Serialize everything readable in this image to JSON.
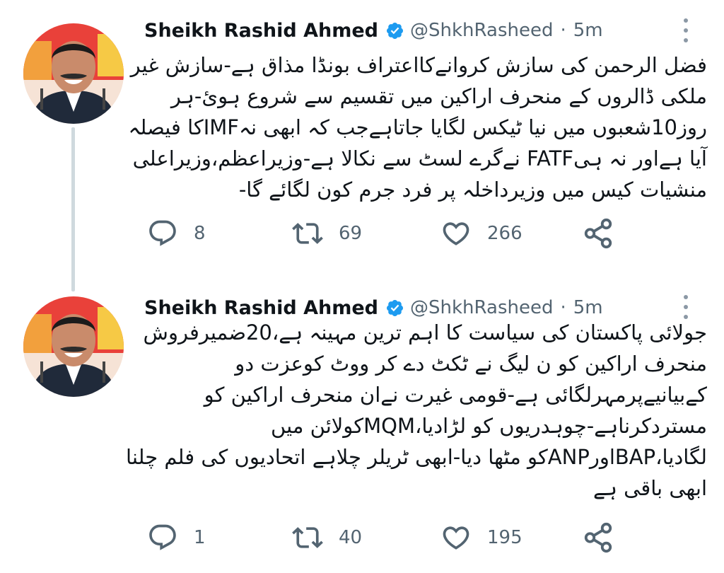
{
  "colors": {
    "verified": "#1d9bf0",
    "text": "#0f1419",
    "secondary": "#536471",
    "thread_line": "#cfd9de",
    "icon": "#536471"
  },
  "tweets": [
    {
      "author": {
        "name": "Sheikh Rashid Ahmed",
        "handle": "@ShkhRasheed",
        "verified": true
      },
      "separator": "·",
      "time": "5m",
      "text_lines": [
        "فضل الرحمن کی سازش کروانےکااعتراف بونڈا مذاق ہے-سازش غیر",
        "ملکی ڈالروں کے منحرف اراکین میں تقسیم سے شروع ہوئ-ہر",
        "روز10شعبوں میں نیا ٹیکس لگایا جاتاہےجب کہ ابھی نہIMFکا فیصلہ",
        "آیا ہےاور نہ ہیFATF نےگرے لسٹ سے نکالا ہے-وزیراعظم،وزیراعلی",
        "منشیات کیس میں وزیرداخلہ پر فرد جرم کون لگائے گا-"
      ],
      "stats": {
        "replies": "8",
        "retweets": "69",
        "likes": "266"
      },
      "icons": [
        "reply-icon",
        "retweet-icon",
        "like-icon",
        "share-icon",
        "more-icon",
        "verified-badge-icon"
      ]
    },
    {
      "author": {
        "name": "Sheikh Rashid Ahmed",
        "handle": "@ShkhRasheed",
        "verified": true
      },
      "separator": "·",
      "time": "5m",
      "text_lines": [
        "جولائی پاکستان کی سیاست کا اہم ترین مہینہ ہے،20ضمیرفروش",
        "منحرف اراکین کو ن لیگ نے ٹکٹ دے کر ووٹ کوعزت دو",
        "کےبیانیےپرمہرلگائی ہے-قومی غیرت نےان منحرف اراکین کو",
        "مستردکرناہے-چوہدریوں کو لڑادیا،MQMکولائن میں",
        "لگادیا،BAPاورANPکو مٹھا دیا-ابھی ٹریلر چلاہے اتحادیوں کی فلم چلنا",
        "ابھی باقی ہے"
      ],
      "stats": {
        "replies": "1",
        "retweets": "40",
        "likes": "195"
      },
      "icons": [
        "reply-icon",
        "retweet-icon",
        "like-icon",
        "share-icon",
        "more-icon",
        "verified-badge-icon"
      ]
    }
  ]
}
